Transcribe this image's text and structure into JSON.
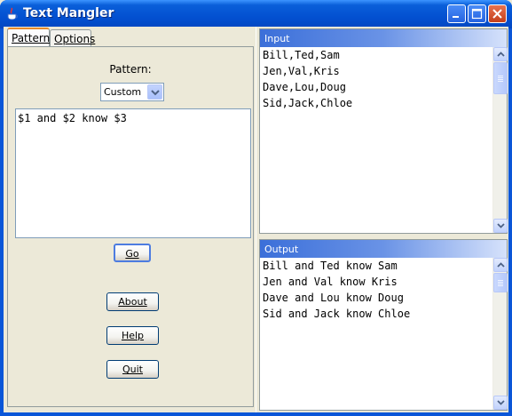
{
  "window": {
    "title": "Text Mangler"
  },
  "tabs": [
    {
      "label": "Pattern",
      "active": true
    },
    {
      "label": "Options",
      "active": false
    }
  ],
  "pattern": {
    "label": "Pattern:",
    "selected": "Custom",
    "text": "$1 and $2 know $3"
  },
  "buttons": {
    "go": "Go",
    "about": "About",
    "help": "Help",
    "quit": "Quit"
  },
  "input_panel": {
    "title": "Input",
    "lines": [
      "Bill,Ted,Sam",
      "Jen,Val,Kris",
      "Dave,Lou,Doug",
      "Sid,Jack,Chloe"
    ]
  },
  "output_panel": {
    "title": "Output",
    "lines": [
      "Bill and Ted know Sam",
      "Jen and Val know Kris",
      "Dave and Lou know Doug",
      "Sid and Jack know Chloe"
    ]
  },
  "colors": {
    "titlebar": "#0350d1",
    "panel_header": "#3b6fd9",
    "active_tab_accent": "#e68b2c"
  }
}
